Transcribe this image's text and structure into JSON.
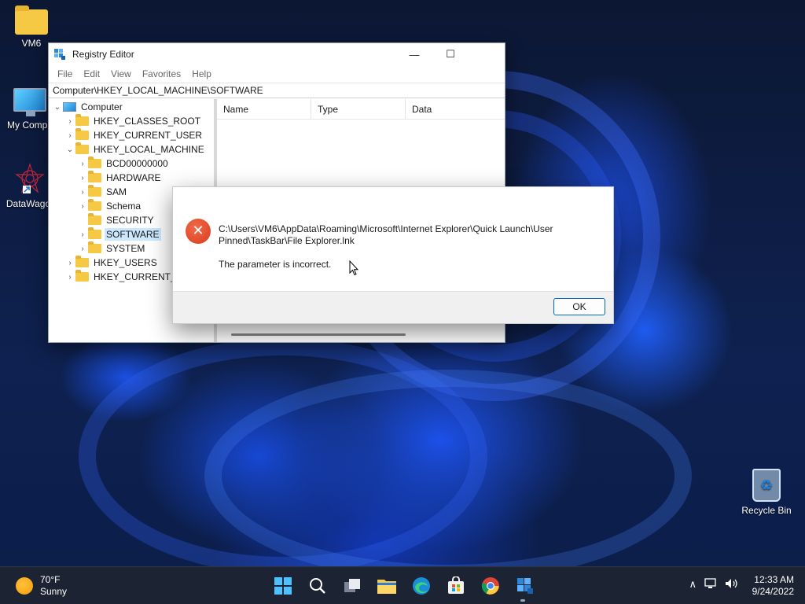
{
  "desktop": {
    "icons": [
      {
        "label": "VM6",
        "icon": "folder-icon"
      },
      {
        "label": "My Compu",
        "icon": "computer-icon"
      },
      {
        "label": "DataWagor",
        "icon": "datawagon-shortcut-icon"
      },
      {
        "label": "Recycle Bin",
        "icon": "recycle-bin-icon"
      }
    ]
  },
  "regedit": {
    "title": "Registry Editor",
    "menu": [
      "File",
      "Edit",
      "View",
      "Favorites",
      "Help"
    ],
    "address": "Computer\\HKEY_LOCAL_MACHINE\\SOFTWARE",
    "tree": [
      {
        "label": "Computer",
        "depth": 0,
        "expander": "⌄"
      },
      {
        "label": "HKEY_CLASSES_ROOT",
        "depth": 1,
        "expander": "›"
      },
      {
        "label": "HKEY_CURRENT_USER",
        "depth": 1,
        "expander": "›"
      },
      {
        "label": "HKEY_LOCAL_MACHINE",
        "depth": 1,
        "expander": "⌄"
      },
      {
        "label": "BCD00000000",
        "depth": 2,
        "expander": "›"
      },
      {
        "label": "HARDWARE",
        "depth": 2,
        "expander": "›"
      },
      {
        "label": "SAM",
        "depth": 2,
        "expander": "›"
      },
      {
        "label": "Schema",
        "depth": 2,
        "expander": "›"
      },
      {
        "label": "SECURITY",
        "depth": 2,
        "expander": ""
      },
      {
        "label": "SOFTWARE",
        "depth": 2,
        "expander": "›",
        "selected": true
      },
      {
        "label": "SYSTEM",
        "depth": 2,
        "expander": "›"
      },
      {
        "label": "HKEY_USERS",
        "depth": 1,
        "expander": "›"
      },
      {
        "label": "HKEY_CURRENT_CO",
        "depth": 1,
        "expander": "›"
      }
    ],
    "columns": [
      "Name",
      "Type",
      "Data"
    ]
  },
  "error_dialog": {
    "path": "C:\\Users\\VM6\\AppData\\Roaming\\Microsoft\\Internet Explorer\\Quick Launch\\User Pinned\\TaskBar\\File Explorer.lnk",
    "message": "The parameter is incorrect.",
    "ok_label": "OK",
    "icon_glyph": "✕"
  },
  "taskbar": {
    "weather_temp": "70°F",
    "weather_desc": "Sunny",
    "apps": [
      "start-icon",
      "search-icon",
      "task-view-icon",
      "file-explorer-icon",
      "edge-icon",
      "store-icon",
      "chrome-icon",
      "regedit-icon"
    ],
    "tray_chevron": "∧",
    "time": "12:33 AM",
    "date": "9/24/2022"
  }
}
